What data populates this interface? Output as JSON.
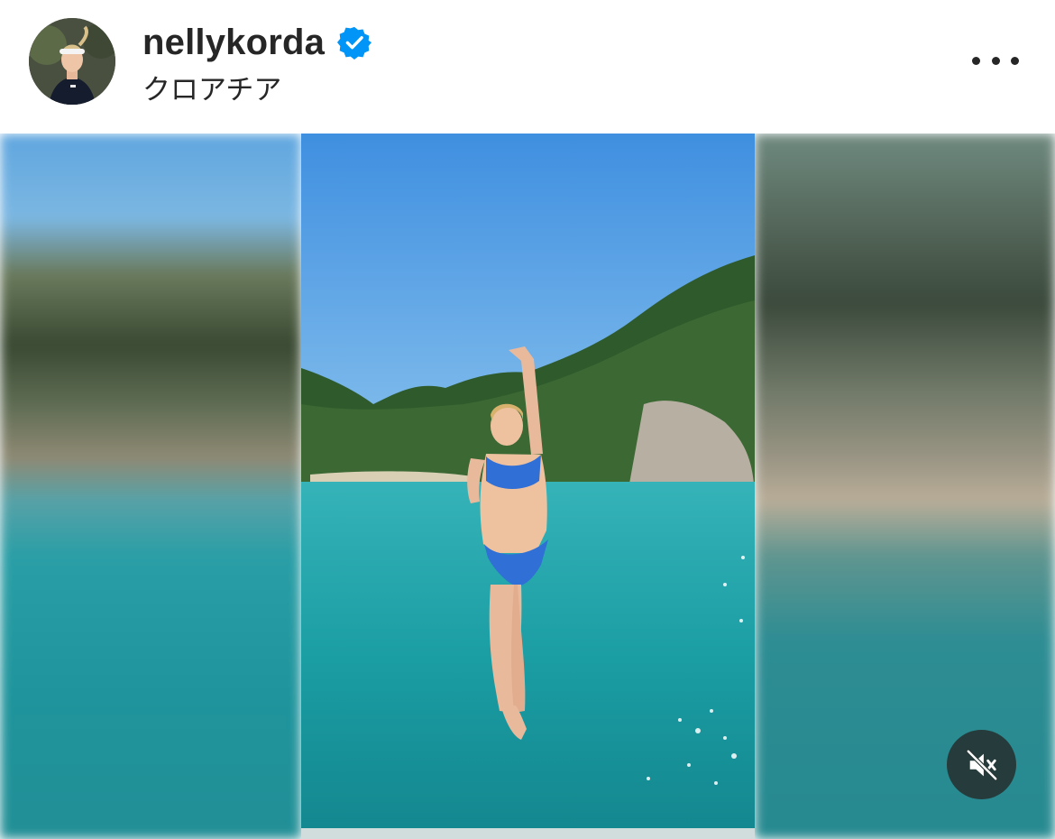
{
  "post_header": {
    "username": "nellykorda",
    "verified": true,
    "location": "クロアチア",
    "avatar_icon": "profile-photo",
    "more_icon": "more-options-icon"
  },
  "media": {
    "type": "video",
    "muted": true,
    "mute_icon": "speaker-muted-icon"
  },
  "colors": {
    "verified_blue": "#0095f6",
    "text_primary": "#262626",
    "mute_button_bg": "#263434"
  }
}
